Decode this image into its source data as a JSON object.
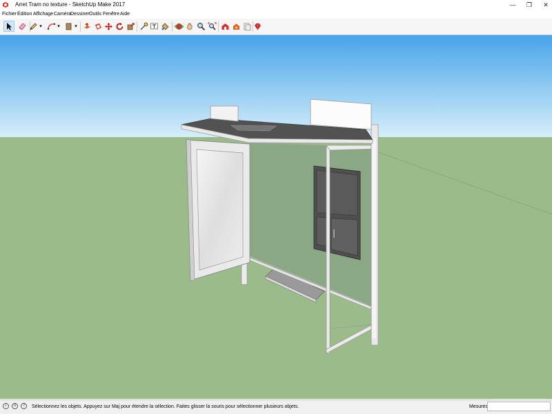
{
  "window": {
    "title": "Arret Tram no texture - SketchUp Make 2017",
    "minimize_glyph": "—",
    "maximize_glyph": "❐",
    "close_glyph": "✕"
  },
  "menu": [
    "Fichier",
    "Édition",
    "Affichage",
    "Caméra",
    "Dessiner",
    "Outils",
    "Fenêtre",
    "Aide"
  ],
  "toolbar": {
    "tools": [
      {
        "name": "select-tool",
        "icon": "arrow-cursor-icon",
        "active": true
      },
      {
        "name": "eraser-tool",
        "icon": "eraser-icon"
      },
      {
        "name": "line-tool",
        "icon": "pencil-icon"
      },
      {
        "name": "arc-tool",
        "icon": "arc-icon"
      },
      {
        "name": "shape-tool",
        "icon": "rectangle-icon"
      },
      {
        "name": "push-pull-tool",
        "icon": "push-pull-icon"
      },
      {
        "name": "offset-tool",
        "icon": "offset-icon"
      },
      {
        "name": "move-tool",
        "icon": "move-icon"
      },
      {
        "name": "rotate-tool",
        "icon": "rotate-icon"
      },
      {
        "name": "scale-tool",
        "icon": "scale-icon"
      },
      {
        "name": "tape-measure-tool",
        "icon": "tape-measure-icon"
      },
      {
        "name": "text-tool",
        "icon": "text-icon"
      },
      {
        "name": "paint-bucket-tool",
        "icon": "paint-bucket-icon"
      },
      {
        "name": "orbit-tool",
        "icon": "orbit-icon"
      },
      {
        "name": "pan-tool",
        "icon": "hand-icon"
      },
      {
        "name": "zoom-tool",
        "icon": "magnifier-icon"
      },
      {
        "name": "zoom-extents-tool",
        "icon": "zoom-extents-icon"
      },
      {
        "name": "warehouse-tool",
        "icon": "warehouse-icon"
      },
      {
        "name": "extension-warehouse-tool",
        "icon": "extension-warehouse-icon"
      },
      {
        "name": "send-to-layout-tool",
        "icon": "layout-icon"
      },
      {
        "name": "extension-manager-tool",
        "icon": "ruby-gem-icon"
      }
    ],
    "dropdown_glyph": "▾"
  },
  "status": {
    "message": "Sélectionnez les objets. Appuyez sur Maj pour étendre la sélection. Faites glisser la souris pour sélectionner plusieurs objets.",
    "measure_label": "Mesures",
    "measure_value": "",
    "icon_info": "i",
    "icon_geo": "0",
    "icon_user": "?"
  },
  "colors": {
    "sky_top": "#4aa6e8",
    "sky_bottom": "#d3ecf8",
    "ground": "#9bbb8a",
    "glass": "#8fac85",
    "frame": "#e6e6e6",
    "roof": "#555555",
    "panel": "#525252"
  }
}
